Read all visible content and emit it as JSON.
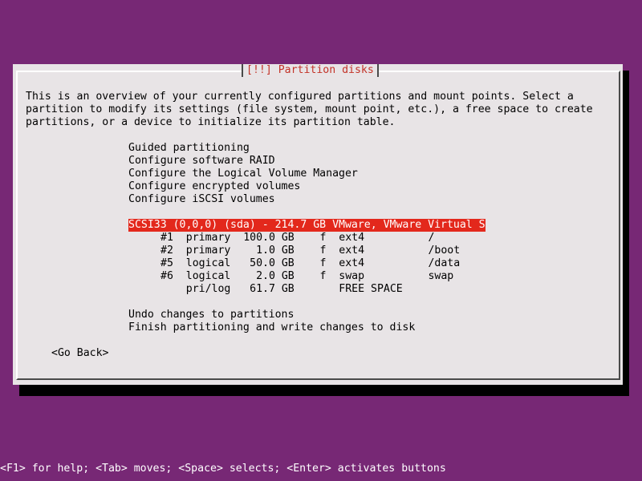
{
  "dialog": {
    "title": "[!!] Partition disks",
    "intro": [
      "This is an overview of your currently configured partitions and mount points. Select a",
      "partition to modify its settings (file system, mount point, etc.), a free space to create",
      "partitions, or a device to initialize its partition table."
    ],
    "menu_items": [
      "Guided partitioning",
      "Configure software RAID",
      "Configure the Logical Volume Manager",
      "Configure encrypted volumes",
      "Configure iSCSI volumes"
    ],
    "disk": "SCSI33 (0,0,0) (sda) - 214.7 GB VMware, VMware Virtual S",
    "partitions": [
      "#1  primary  100.0 GB    f  ext4          /",
      "#2  primary    1.0 GB    f  ext4          /boot",
      "#5  logical   50.0 GB    f  ext4          /data",
      "#6  logical    2.0 GB    f  swap          swap",
      "    pri/log   61.7 GB       FREE SPACE"
    ],
    "actions": [
      "Undo changes to partitions",
      "Finish partitioning and write changes to disk"
    ],
    "go_back": "<Go Back>"
  },
  "footer": "<F1> for help; <Tab> moves; <Space> selects; <Enter> activates buttons",
  "colors": {
    "background": "#772875",
    "dialog": "#e8e4e6",
    "title_text": "#c33328",
    "selection": "#e3281c"
  }
}
